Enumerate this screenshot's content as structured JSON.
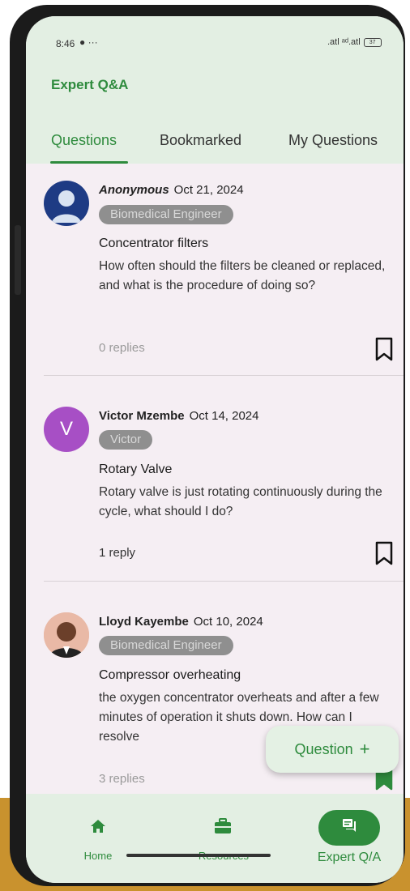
{
  "status": {
    "time": "8:46",
    "signal": ".atl ᵃᵈ.atl",
    "battery": "37"
  },
  "app": {
    "title": "Expert Q&A"
  },
  "tabs": [
    {
      "label": "Questions",
      "active": true
    },
    {
      "label": "Bookmarked",
      "active": false
    },
    {
      "label": "My Questions",
      "active": false
    }
  ],
  "questions": [
    {
      "author": "Anonymous",
      "date": "Oct 21, 2024",
      "role": "Biomedical Engineer",
      "title": "Concentrator filters",
      "body": "How often should the filters be cleaned or replaced, and what is the procedure of doing so?",
      "replies": "0 replies",
      "avatar": "anonymous-avatar",
      "bookmarked": false
    },
    {
      "author": "Victor Mzembe",
      "date": "Oct 14, 2024",
      "role": "Victor",
      "title": "Rotary Valve",
      "body": "Rotary valve is just rotating continuously during the cycle, what should I do?",
      "replies": "1 reply",
      "avatar_letter": "V",
      "bookmarked": false
    },
    {
      "author": "Lloyd Kayembe",
      "date": "Oct 10, 2024",
      "role": "Biomedical Engineer",
      "title": "Compressor overheating",
      "body": "the oxygen concentrator overheats and after a few minutes of operation it shuts down. How can I resolve",
      "replies": "3 replies",
      "avatar": "photo-avatar",
      "bookmarked": true
    }
  ],
  "fab": {
    "label": "Question",
    "icon": "+"
  },
  "nav": [
    {
      "label": "Home",
      "icon": "home-icon"
    },
    {
      "label": "Resources",
      "icon": "briefcase-icon"
    },
    {
      "label": "Expert Q/A",
      "icon": "forum-icon",
      "active": true
    }
  ],
  "colors": {
    "accent": "#2e8b3d",
    "header_bg": "#e3efe3",
    "page_bg": "#f5eef3",
    "badge_bg": "#8f8f8f"
  }
}
